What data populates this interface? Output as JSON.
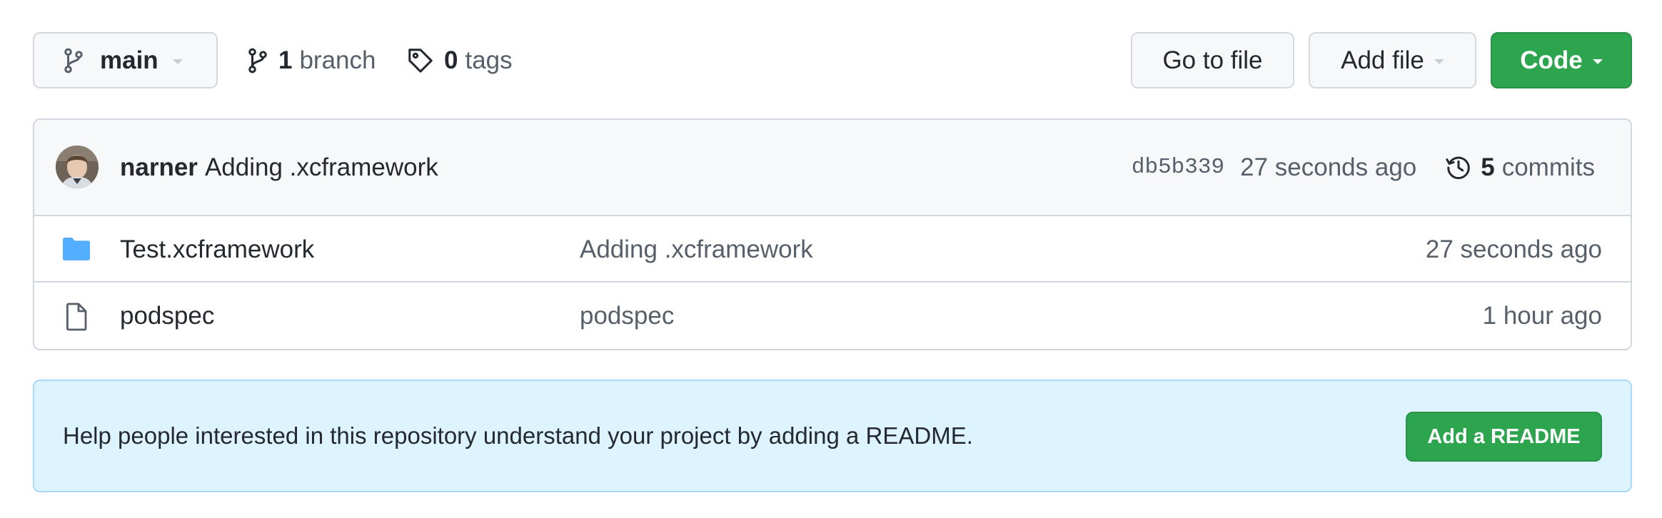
{
  "toolbar": {
    "branch_selector": {
      "label": "main"
    },
    "branches": {
      "count": "1",
      "label": "branch"
    },
    "tags": {
      "count": "0",
      "label": "tags"
    },
    "go_to_file": "Go to file",
    "add_file": "Add file",
    "code": "Code"
  },
  "latest_commit": {
    "author": "narner",
    "message": "Adding .xcframework",
    "sha": "db5b339",
    "time": "27 seconds ago",
    "commits_count": "5",
    "commits_label": "commits"
  },
  "files": [
    {
      "type": "folder",
      "icon": "folder-icon",
      "name": "Test.xcframework",
      "message": "Adding .xcframework",
      "time": "27 seconds ago"
    },
    {
      "type": "file",
      "icon": "file-icon",
      "name": "podspec",
      "message": "podspec",
      "time": "1 hour ago"
    }
  ],
  "readme_banner": {
    "text": "Help people interested in this repository understand your project by adding a README.",
    "button": "Add a README"
  },
  "colors": {
    "primary_green": "#2da44e",
    "folder_blue": "#54aeff",
    "banner_bg": "#ddf4ff",
    "muted_text": "#57606a"
  }
}
